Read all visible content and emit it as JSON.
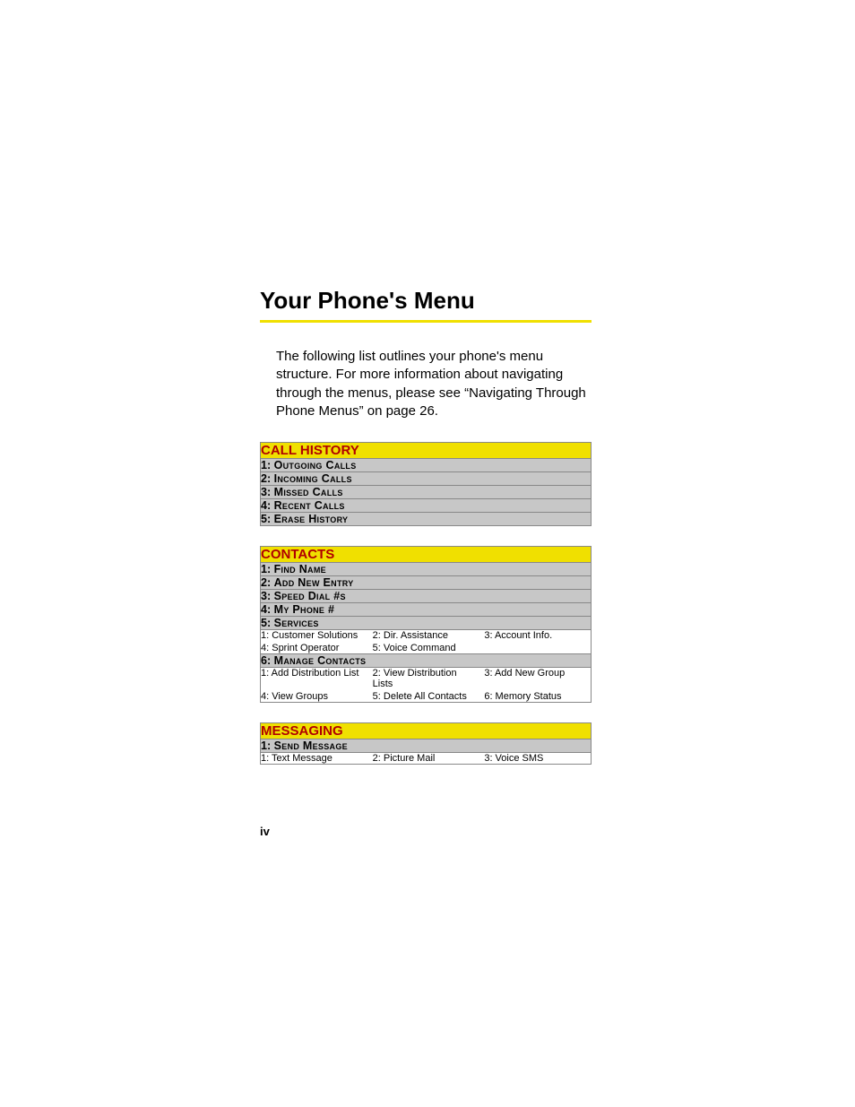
{
  "title": "Your Phone's Menu",
  "intro": "The following list outlines your phone's menu structure. For more information about navigating through the menus, please see “Navigating Through Phone Menus” on page 26.",
  "page_number": "iv",
  "sections": {
    "call_history": {
      "header": "CALL HISTORY",
      "items": [
        {
          "num": "1:",
          "label": "Outgoing Calls"
        },
        {
          "num": "2:",
          "label": "Incoming Calls"
        },
        {
          "num": "3:",
          "label": "Missed Calls"
        },
        {
          "num": "4:",
          "label": "Recent Calls"
        },
        {
          "num": "5:",
          "label": "Erase History"
        }
      ]
    },
    "contacts": {
      "header": "CONTACTS",
      "items": [
        {
          "num": "1:",
          "label": "Find Name"
        },
        {
          "num": "2:",
          "label": "Add New Entry"
        },
        {
          "num": "3:",
          "label": "Speed Dial #s"
        },
        {
          "num": "4:",
          "label": "My Phone #"
        },
        {
          "num": "5:",
          "label": "Services",
          "sub": [
            "1: Customer Solutions",
            "2: Dir. Assistance",
            "3: Account Info.",
            "4: Sprint Operator",
            "5: Voice Command",
            ""
          ]
        },
        {
          "num": "6:",
          "label": "Manage Contacts",
          "sub": [
            "1: Add Distribution List",
            "2: View Distribution Lists",
            "3: Add New Group",
            "4: View Groups",
            "5: Delete All Contacts",
            "6: Memory Status"
          ]
        }
      ]
    },
    "messaging": {
      "header": "MESSAGING",
      "items": [
        {
          "num": "1:",
          "label": "Send Message",
          "sub": [
            "1: Text Message",
            "2: Picture Mail",
            "3: Voice SMS"
          ]
        }
      ]
    }
  },
  "chart_data": {
    "type": "table",
    "title": "Phone Menu Structure",
    "menus": [
      {
        "name": "CALL HISTORY",
        "items": [
          "1: Outgoing Calls",
          "2: Incoming Calls",
          "3: Missed Calls",
          "4: Recent Calls",
          "5: Erase History"
        ]
      },
      {
        "name": "CONTACTS",
        "items": [
          "1: Find Name",
          "2: Add New Entry",
          "3: Speed Dial #s",
          "4: My Phone #",
          {
            "name": "5: Services",
            "sub": [
              "1: Customer Solutions",
              "2: Dir. Assistance",
              "3: Account Info.",
              "4: Sprint Operator",
              "5: Voice Command"
            ]
          },
          {
            "name": "6: Manage Contacts",
            "sub": [
              "1: Add Distribution List",
              "2: View Distribution Lists",
              "3: Add New Group",
              "4: View Groups",
              "5: Delete All Contacts",
              "6: Memory Status"
            ]
          }
        ]
      },
      {
        "name": "MESSAGING",
        "items": [
          {
            "name": "1: Send Message",
            "sub": [
              "1: Text Message",
              "2: Picture Mail",
              "3: Voice SMS"
            ]
          }
        ]
      }
    ]
  }
}
